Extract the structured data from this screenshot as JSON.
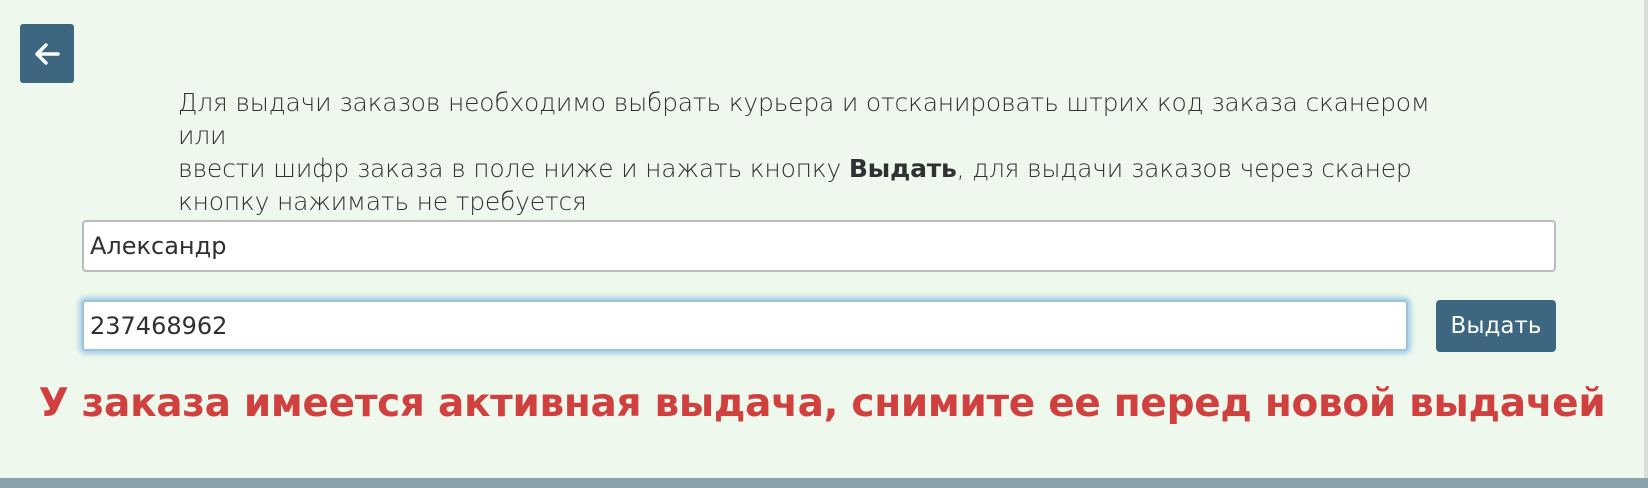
{
  "header": {
    "back_icon": "arrow-left-icon"
  },
  "instructions": {
    "line1": "Для выдачи заказов необходимо выбрать курьера и отсканировать штрих код заказа сканером или",
    "line2_before": "ввести шифр заказа в поле ниже и нажать кнопку ",
    "line2_bold": "Выдать",
    "line2_after": ", для выдачи заказов через сканер",
    "line3": "кнопку нажимать не требуется"
  },
  "form": {
    "courier_value": "Александр",
    "order_code_value": "237468962",
    "issue_button_label": "Выдать"
  },
  "status": {
    "error_message": "У заказа имеется активная выдача, снимите ее перед новой выдачей",
    "error_color": "#d0403f"
  },
  "colors": {
    "accent": "#3d6680",
    "background": "#eff8ec"
  }
}
